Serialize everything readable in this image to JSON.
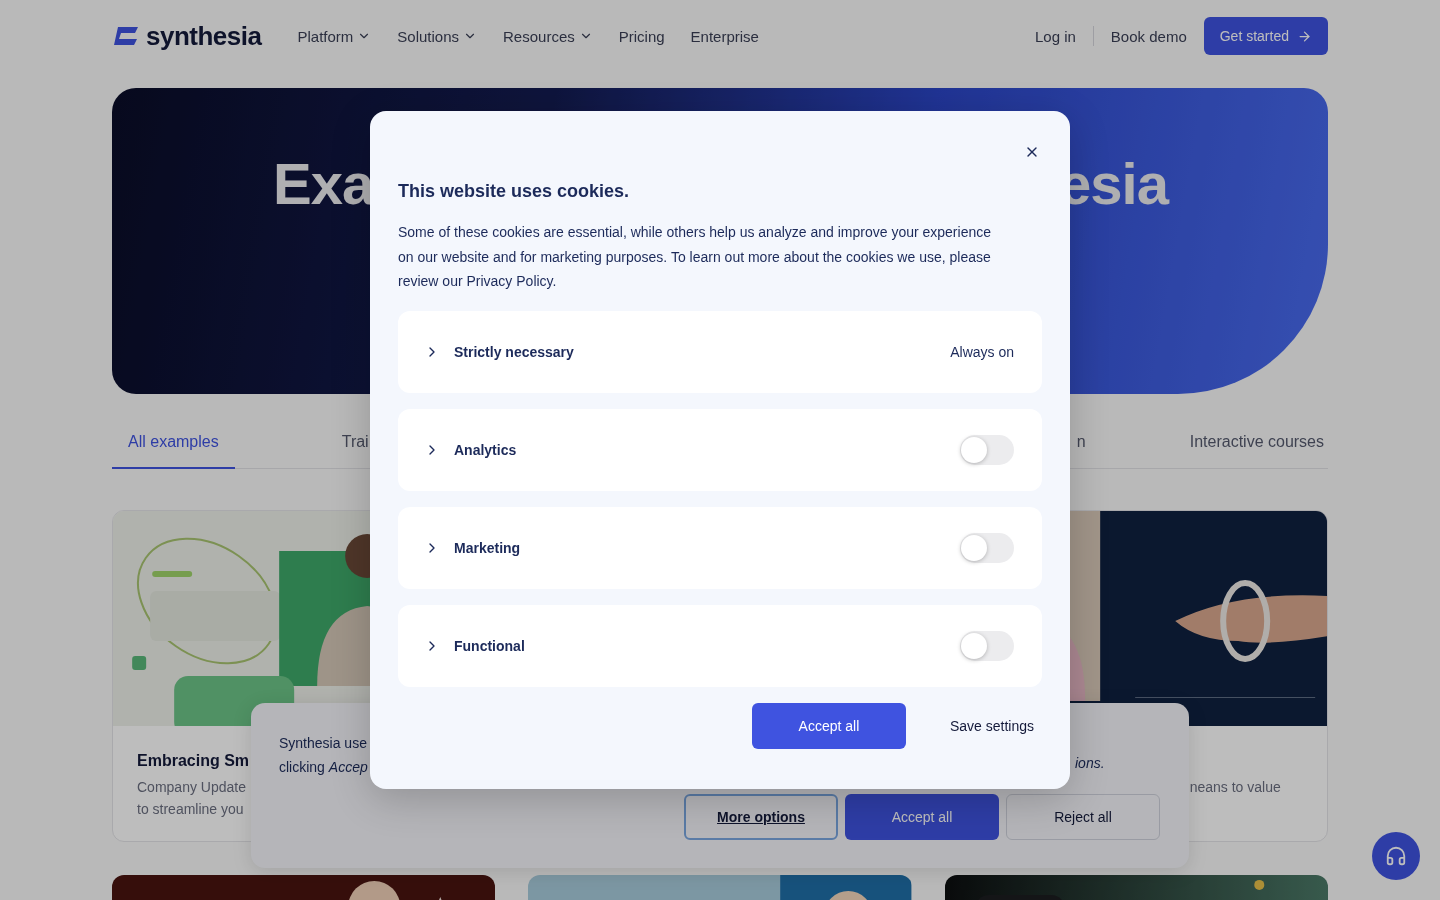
{
  "nav": {
    "logo": "synthesia",
    "items": [
      {
        "label": "Platform",
        "has_menu": true
      },
      {
        "label": "Solutions",
        "has_menu": true
      },
      {
        "label": "Resources",
        "has_menu": true
      },
      {
        "label": "Pricing",
        "has_menu": false
      },
      {
        "label": "Enterprise",
        "has_menu": false
      }
    ],
    "login": "Log in",
    "demo": "Book demo",
    "cta": "Get started"
  },
  "hero": {
    "title_left": "Exa",
    "title_right": "esia"
  },
  "tabs": [
    {
      "label": "All examples",
      "selected": true
    },
    {
      "label": "Trai",
      "selected": false
    },
    {
      "label": "n",
      "selected": false
    },
    {
      "label": "Interactive courses",
      "selected": false
    }
  ],
  "cards": [
    {
      "title": "Embracing Sm",
      "lines": [
        "Company Update",
        "to streamline you"
      ]
    },
    {
      "lines": [
        "neans to value"
      ]
    }
  ],
  "banner": {
    "lines": [
      "Synthesia use",
      "clicking *Accep*"
    ],
    "tail": "ions.",
    "buttons": [
      {
        "label": "More options",
        "kind": "outline"
      },
      {
        "label": "Accept all",
        "kind": "primary"
      },
      {
        "label": "Reject all",
        "kind": "secondary"
      }
    ]
  },
  "modal": {
    "title": "This website uses cookies.",
    "body": "Some of these cookies are essential, while others help us analyze and improve your experience on our website and for marketing purposes. To learn out more about the cookies we use, please review our Privacy Policy.",
    "categories": [
      {
        "label": "Strictly necessary",
        "kind": "always",
        "status": "Always on",
        "expanded": false
      },
      {
        "label": "Analytics",
        "kind": "toggle",
        "on": false,
        "expanded": false
      },
      {
        "label": "Marketing",
        "kind": "toggle",
        "on": false,
        "expanded": false
      },
      {
        "label": "Functional",
        "kind": "toggle",
        "on": false,
        "expanded": false
      }
    ],
    "buttons": [
      {
        "label": "Accept all",
        "kind": "primary"
      },
      {
        "label": "Save settings",
        "kind": "text"
      }
    ]
  }
}
